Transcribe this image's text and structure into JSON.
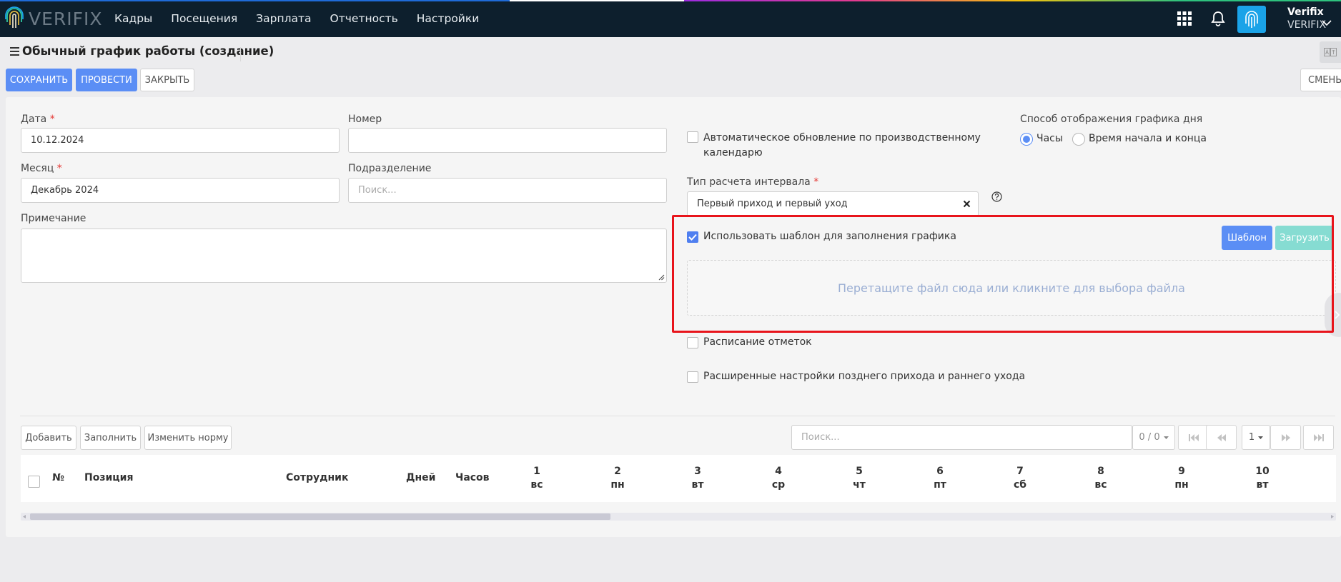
{
  "nav": {
    "logo_text": "VERIFIX",
    "menu": [
      "Кадры",
      "Посещения",
      "Зарплата",
      "Отчетность",
      "Настройки"
    ],
    "user_name": "Verifix",
    "user_org": "VERIFIX"
  },
  "page": {
    "title": "Обычный график работы (создание)",
    "save_label": "СОХРАНИТЬ",
    "post_label": "ПРОВЕСТИ",
    "close_label": "ЗАКРЫТЬ",
    "shifts_label": "СМЕНЫ"
  },
  "form": {
    "date_label": "Дата",
    "date_value": "10.12.2024",
    "number_label": "Номер",
    "number_value": "",
    "month_label": "Месяц",
    "month_value": "Декабрь 2024",
    "division_label": "Подразделение",
    "division_placeholder": "Поиск...",
    "note_label": "Примечание",
    "auto_update_label_line1": "Автоматическое обновление по производственному",
    "auto_update_label_line2": "календарю",
    "display_mode_label": "Способ отображения графика дня",
    "display_mode_hours": "Часы",
    "display_mode_start_end": "Время начала и конца",
    "interval_type_label": "Тип расчета интервала",
    "interval_type_value": "Первый приход и первый уход",
    "use_template_label": "Использовать шаблон для заполнения графика",
    "template_button": "Шаблон",
    "upload_button": "Загрузить",
    "dropzone_text": "Перетащите файл сюда или кликните для выбора файла",
    "marks_schedule_label": "Расписание отметок",
    "advanced_settings_label": "Расширенные настройки позднего прихода и раннего ухода"
  },
  "table_toolbar": {
    "add_label": "Добавить",
    "fill_label": "Заполнить",
    "change_norm_label": "Изменить норму",
    "search_placeholder": "Поиск...",
    "count": "0 / 0",
    "page": "1"
  },
  "table": {
    "columns": [
      "№",
      "Позиция",
      "Сотрудник",
      "Дней",
      "Часов"
    ],
    "days": [
      {
        "num": "1",
        "dow": "вс"
      },
      {
        "num": "2",
        "dow": "пн"
      },
      {
        "num": "3",
        "dow": "вт"
      },
      {
        "num": "4",
        "dow": "ср"
      },
      {
        "num": "5",
        "dow": "чт"
      },
      {
        "num": "6",
        "dow": "пт"
      },
      {
        "num": "7",
        "dow": "сб"
      },
      {
        "num": "8",
        "dow": "вс"
      },
      {
        "num": "9",
        "dow": "пн"
      },
      {
        "num": "10",
        "dow": "вт"
      }
    ]
  },
  "colors": {
    "nav_bg": "#0d1f2d",
    "primary": "#5b8ef5",
    "upload": "#86dcd2",
    "highlight": "#e8141b"
  }
}
